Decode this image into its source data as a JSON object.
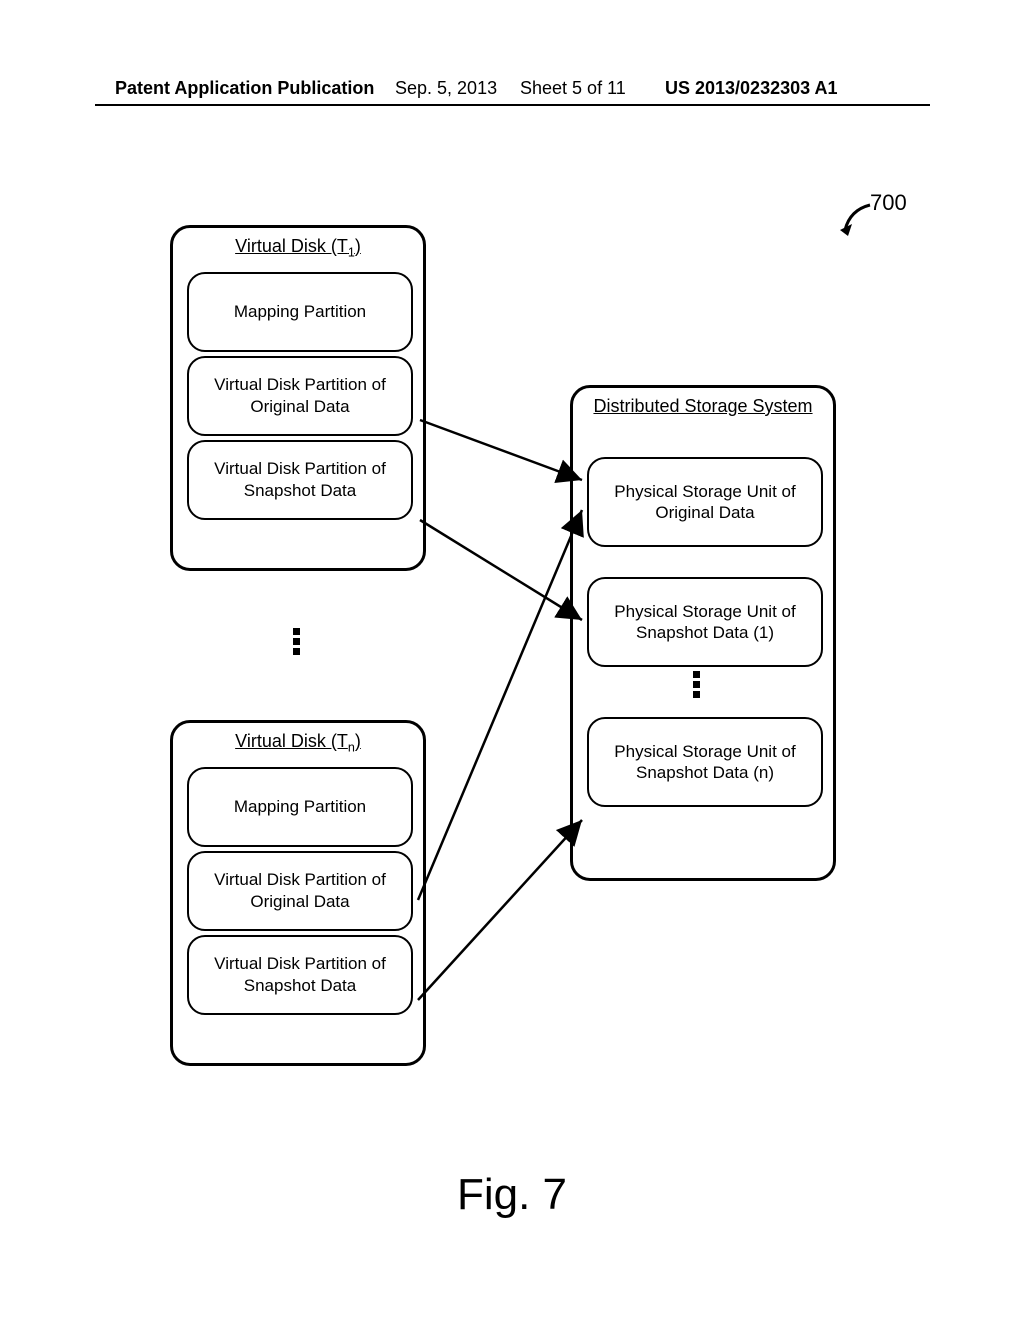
{
  "header": {
    "left": "Patent Application Publication",
    "date": "Sep. 5, 2013",
    "sheet": "Sheet 5 of 11",
    "pubno": "US 2013/0232303 A1"
  },
  "figure_ref": "700",
  "disks": {
    "t1": {
      "title_pre": "Virtual Disk (T",
      "title_sub": "1",
      "title_post": ")",
      "p1": "Mapping Partition",
      "p2": "Virtual Disk Partition of Original Data",
      "p3": "Virtual Disk Partition of Snapshot Data"
    },
    "tn": {
      "title_pre": "Virtual Disk (T",
      "title_sub": "n",
      "title_post": ")",
      "p1": "Mapping Partition",
      "p2": "Virtual Disk Partition of Original Data",
      "p3": "Virtual Disk Partition of Snapshot Data"
    }
  },
  "storage": {
    "title": "Distributed Storage System",
    "u1": "Physical Storage Unit of Original Data",
    "u2": "Physical Storage Unit of Snapshot Data (1)",
    "u3": "Physical Storage Unit of Snapshot Data (n)"
  },
  "caption": "Fig. 7"
}
